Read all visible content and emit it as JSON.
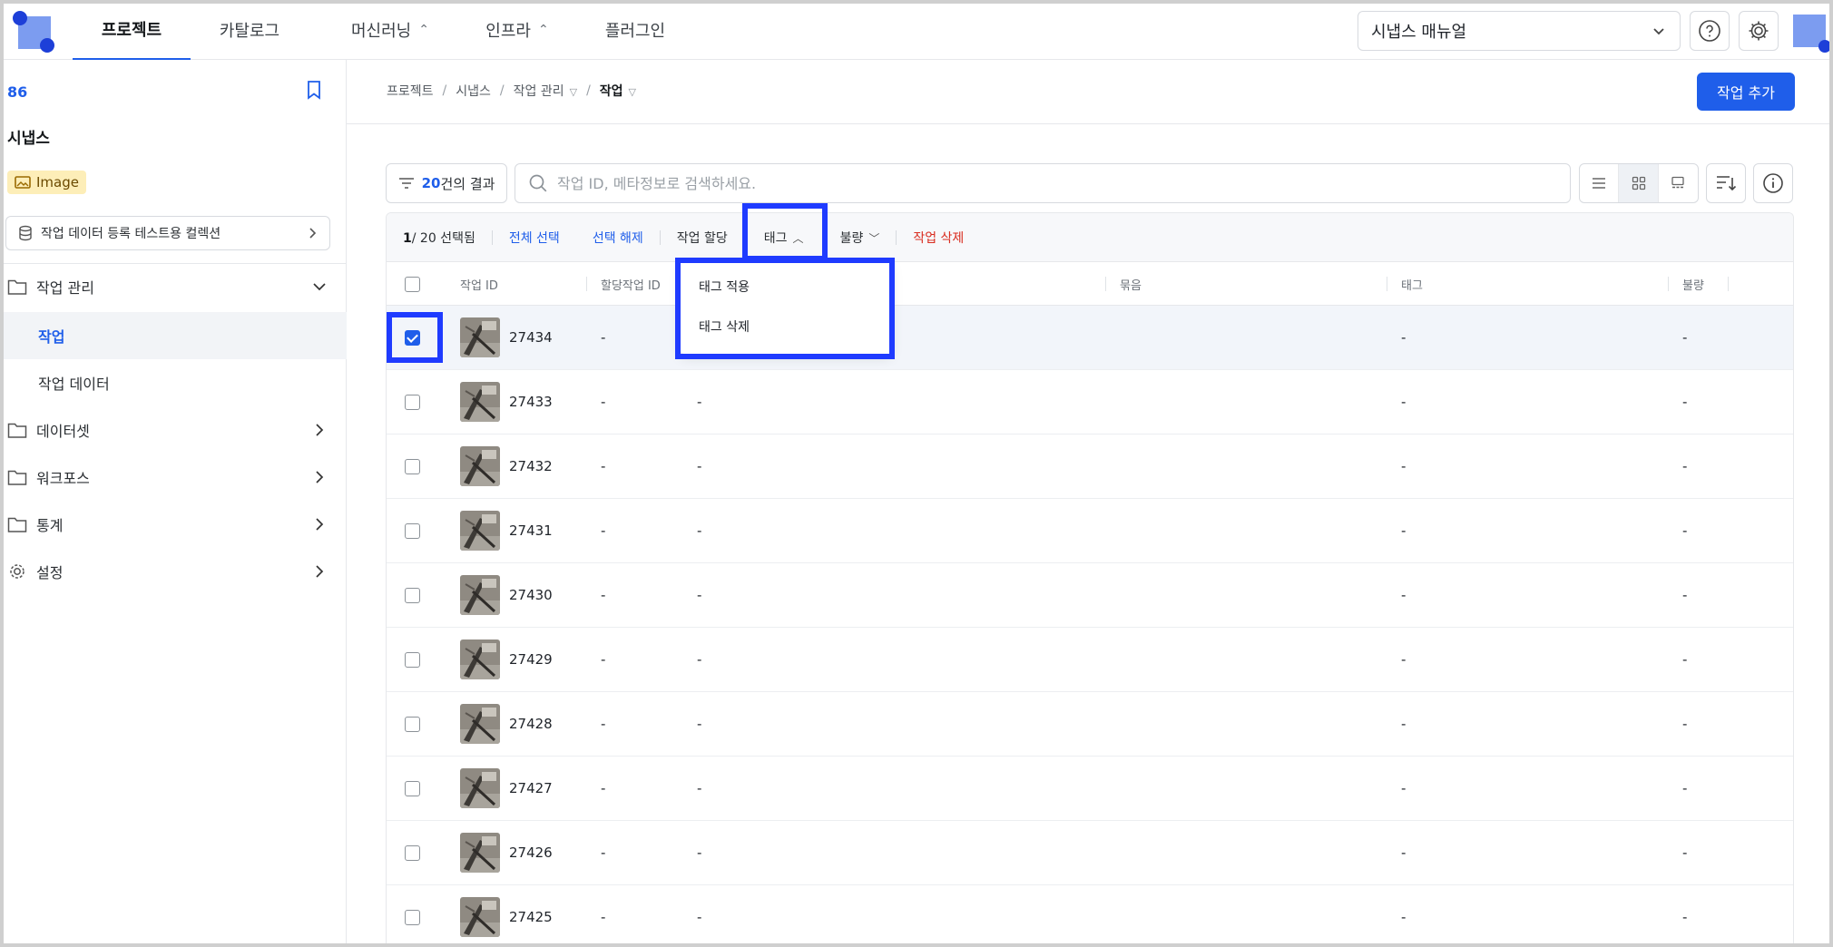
{
  "topnav": {
    "tabs": [
      {
        "label": "프로젝트",
        "active": true
      },
      {
        "label": "카탈로그",
        "active": false
      },
      {
        "label": "머신러닝",
        "active": false
      },
      {
        "label": "인프라",
        "active": false
      },
      {
        "label": "플러그인",
        "active": false
      }
    ],
    "manual_select": "시냅스 매뉴얼"
  },
  "sidebar": {
    "project_id": "86",
    "project_name": "시냅스",
    "badge": "Image",
    "collection": "작업 데이터 등록 테스트용 컬렉션",
    "items": [
      {
        "label": "작업 관리"
      },
      {
        "label": "작업",
        "active": true
      },
      {
        "label": "작업 데이터"
      },
      {
        "label": "데이터셋"
      },
      {
        "label": "워크포스"
      },
      {
        "label": "통계"
      },
      {
        "label": "설정"
      }
    ]
  },
  "breadcrumb": [
    "프로젝트",
    "시냅스",
    "작업 관리",
    "작업"
  ],
  "add_button": "작업 추가",
  "toolbar": {
    "result_count": "20",
    "result_suffix": "건의 결과",
    "search_placeholder": "작업 ID, 메타정보로 검색하세요."
  },
  "selection_bar": {
    "selected": "1",
    "total": "/ 20",
    "selected_suffix": " 선택됨",
    "select_all": "전체 선택",
    "deselect": "선택 해제",
    "assign": "작업 할당",
    "tag": "태그",
    "defect": "불량",
    "delete": "작업 삭제"
  },
  "tag_menu": [
    "태그 적용",
    "태그 삭제"
  ],
  "table": {
    "columns": [
      "작업 ID",
      "할당작업 ID",
      "묶음",
      "태그",
      "불량"
    ],
    "rows": [
      {
        "id": "27434",
        "assigned": "-",
        "worker": "",
        "tag": "-",
        "defect": "-",
        "checked": true
      },
      {
        "id": "27433",
        "assigned": "-",
        "worker": "-",
        "tag": "-",
        "defect": "-",
        "checked": false
      },
      {
        "id": "27432",
        "assigned": "-",
        "worker": "-",
        "tag": "-",
        "defect": "-",
        "checked": false
      },
      {
        "id": "27431",
        "assigned": "-",
        "worker": "-",
        "tag": "-",
        "defect": "-",
        "checked": false
      },
      {
        "id": "27430",
        "assigned": "-",
        "worker": "-",
        "tag": "-",
        "defect": "-",
        "checked": false
      },
      {
        "id": "27429",
        "assigned": "-",
        "worker": "-",
        "tag": "-",
        "defect": "-",
        "checked": false
      },
      {
        "id": "27428",
        "assigned": "-",
        "worker": "-",
        "tag": "-",
        "defect": "-",
        "checked": false
      },
      {
        "id": "27427",
        "assigned": "-",
        "worker": "-",
        "tag": "-",
        "defect": "-",
        "checked": false
      },
      {
        "id": "27426",
        "assigned": "-",
        "worker": "-",
        "tag": "-",
        "defect": "-",
        "checked": false
      },
      {
        "id": "27425",
        "assigned": "-",
        "worker": "-",
        "tag": "-",
        "defect": "-",
        "checked": false
      }
    ]
  },
  "colors": {
    "accent": "#1f5eea",
    "highlight": "#1f3bff",
    "danger": "#d92d20"
  }
}
